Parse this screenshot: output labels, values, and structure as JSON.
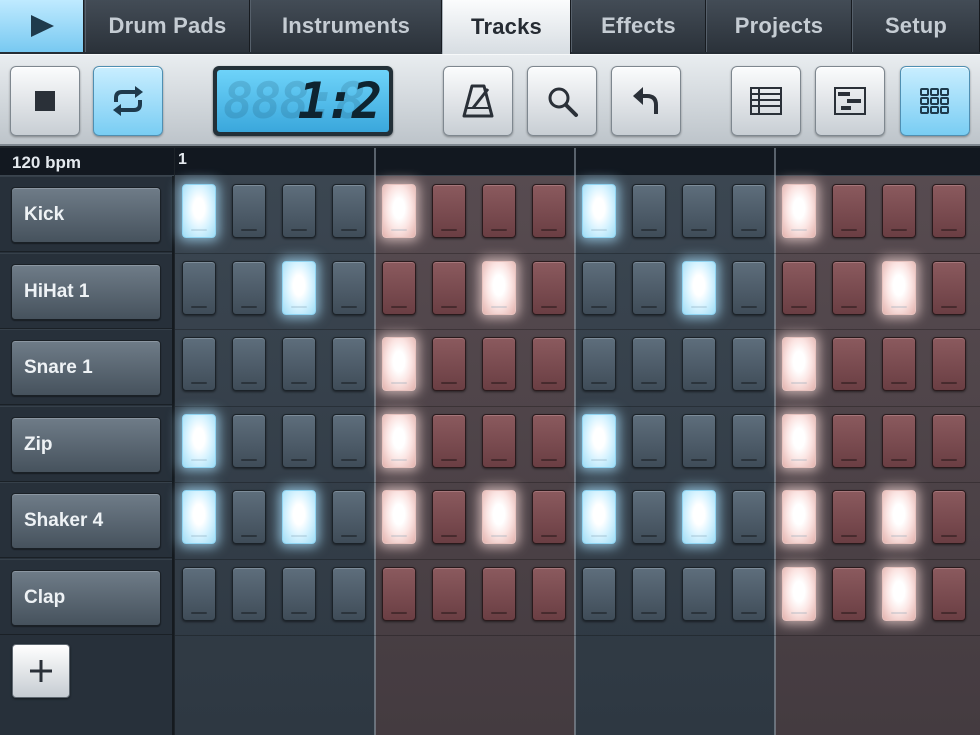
{
  "tabs": [
    {
      "label": "Drum Pads",
      "active": false
    },
    {
      "label": "Instruments",
      "active": false
    },
    {
      "label": "Tracks",
      "active": true
    },
    {
      "label": "Effects",
      "active": false
    },
    {
      "label": "Projects",
      "active": false
    },
    {
      "label": "Setup",
      "active": false
    }
  ],
  "toolbar": {
    "stop_icon": "stop-icon",
    "loop_icon": "loop-icon",
    "loop_active": true,
    "position": "1:2",
    "metronome_icon": "metronome-icon",
    "zoom_icon": "magnifier-icon",
    "undo_icon": "undo-icon",
    "view_list_icon": "list-view-icon",
    "view_piano_icon": "piano-roll-icon",
    "view_grid_icon": "grid-view-icon",
    "grid_view_active": true
  },
  "tempo": "120 bpm",
  "bar_label": "1",
  "tracks": [
    {
      "name": "Kick",
      "steps": [
        1,
        0,
        0,
        0,
        1,
        0,
        0,
        0,
        1,
        0,
        0,
        0,
        1,
        0,
        0,
        0
      ]
    },
    {
      "name": "HiHat 1",
      "steps": [
        0,
        0,
        1,
        0,
        0,
        0,
        1,
        0,
        0,
        0,
        1,
        0,
        0,
        0,
        1,
        0
      ]
    },
    {
      "name": "Snare 1",
      "steps": [
        0,
        0,
        0,
        0,
        1,
        0,
        0,
        0,
        0,
        0,
        0,
        0,
        1,
        0,
        0,
        0
      ]
    },
    {
      "name": "Zip",
      "steps": [
        1,
        0,
        0,
        0,
        1,
        0,
        0,
        0,
        1,
        0,
        0,
        0,
        1,
        0,
        0,
        0
      ]
    },
    {
      "name": "Shaker 4",
      "steps": [
        1,
        0,
        1,
        0,
        1,
        0,
        1,
        0,
        1,
        0,
        1,
        0,
        1,
        0,
        1,
        0
      ]
    },
    {
      "name": "Clap",
      "steps": [
        0,
        0,
        0,
        0,
        0,
        0,
        0,
        0,
        0,
        0,
        0,
        0,
        1,
        0,
        1,
        0
      ]
    }
  ],
  "beat_colors": [
    "blue",
    "red",
    "blue",
    "red"
  ],
  "add_icon": "plus-icon",
  "colors": {
    "accent_blue": "#79cdf3",
    "pad_blue": "#4f5e6b",
    "pad_red": "#7a4a4f"
  }
}
